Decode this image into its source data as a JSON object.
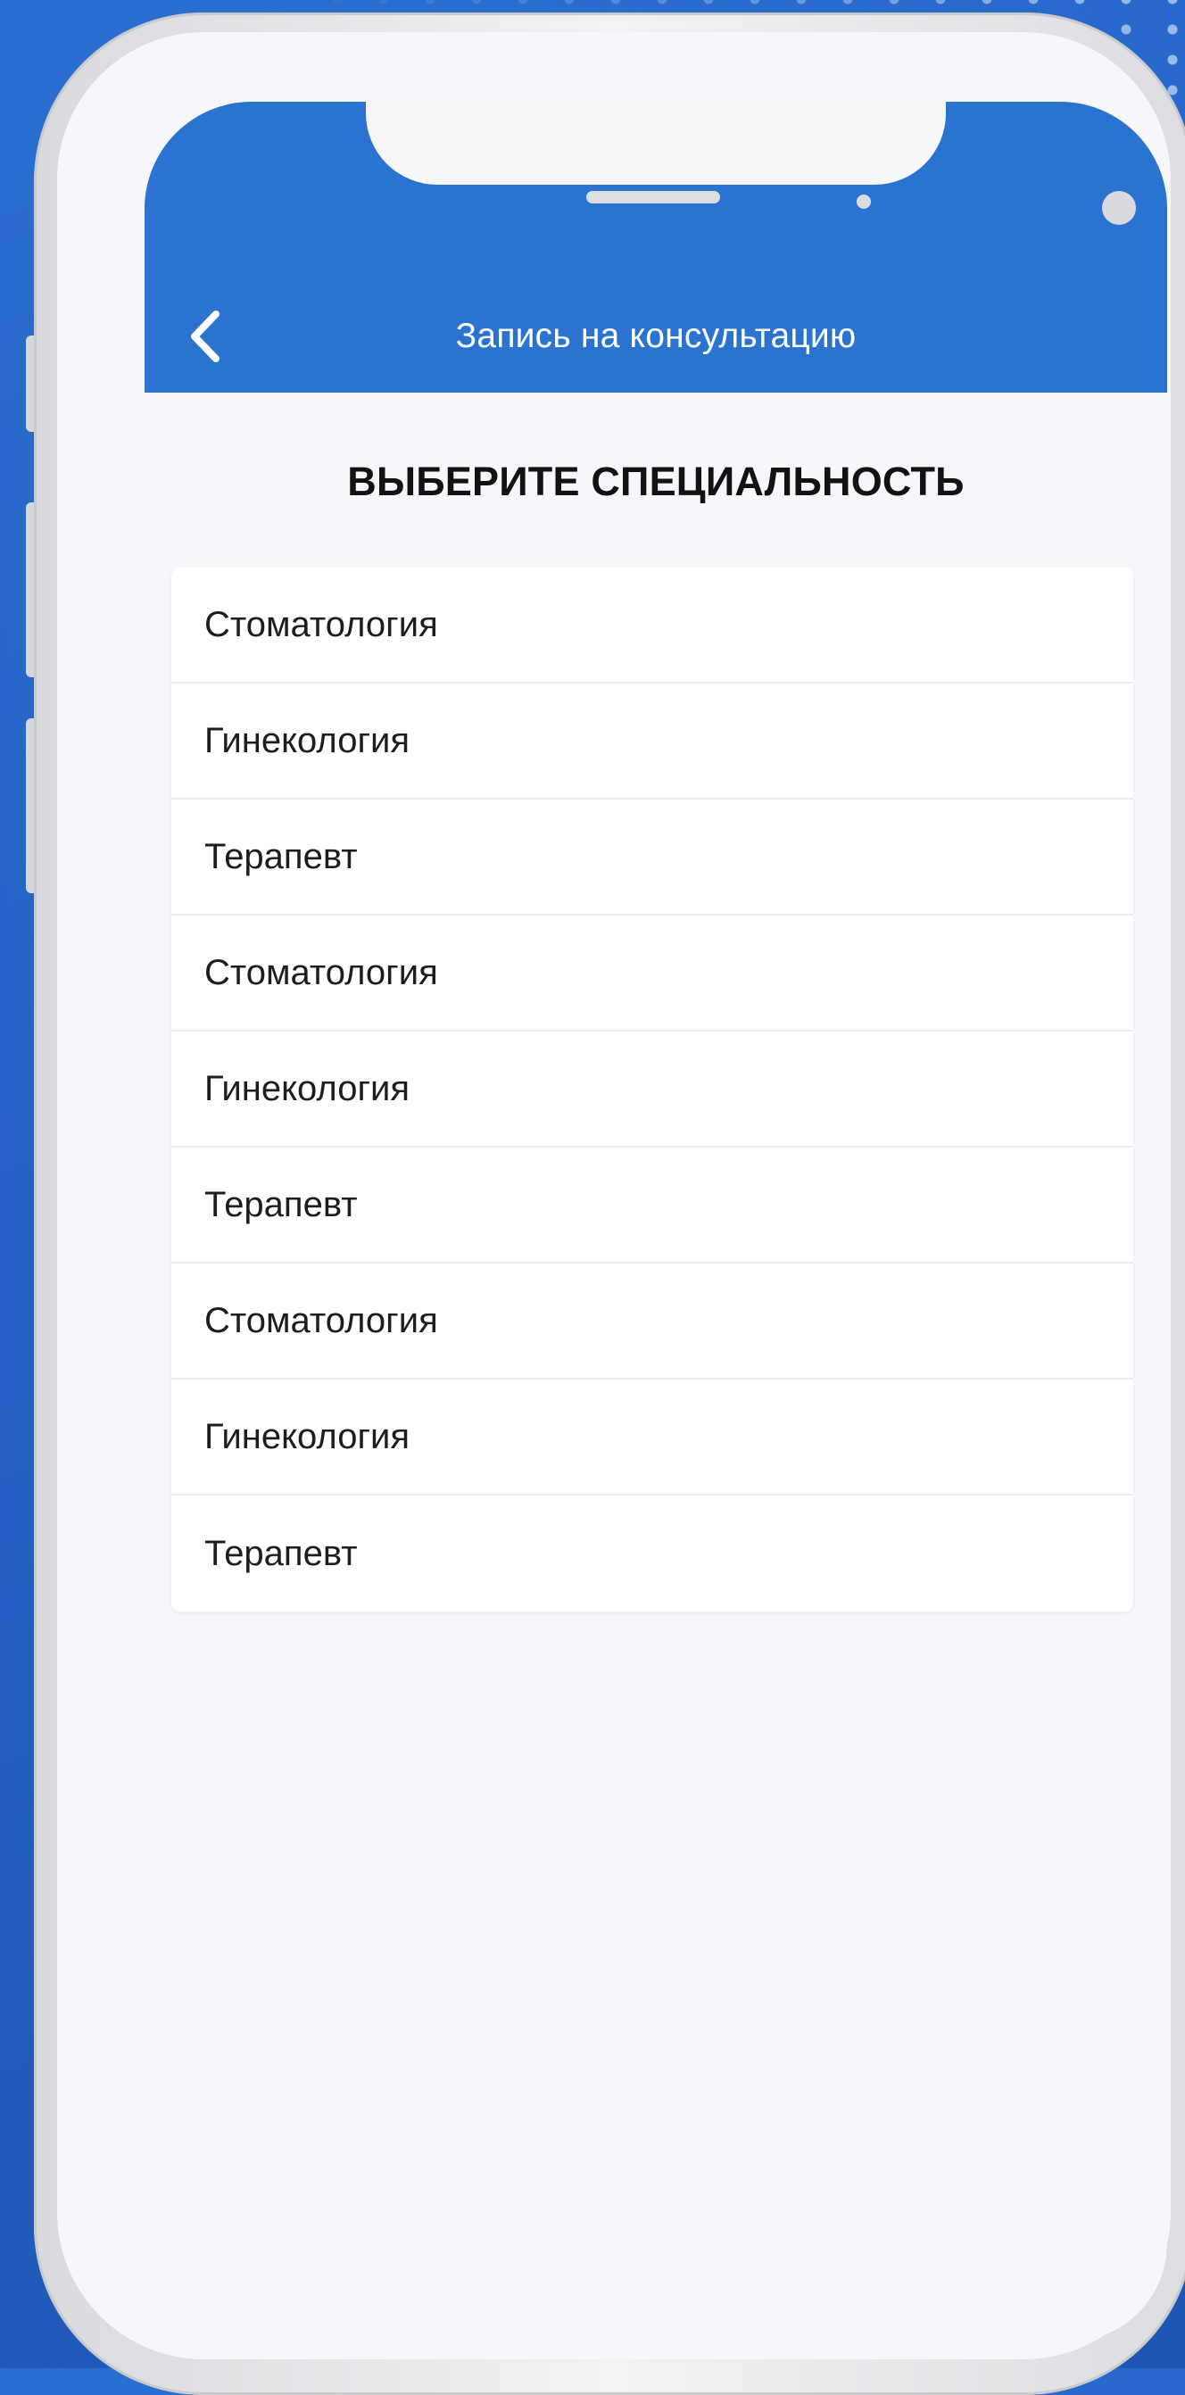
{
  "header": {
    "title": "Запись на консультацию",
    "back_icon": "chevron-left-icon"
  },
  "page": {
    "heading": "ВЫБЕРИТЕ СПЕЦИАЛЬНОСТЬ"
  },
  "specialties": [
    "Стоматология",
    "Гинекология",
    "Терапевт",
    "Стоматология",
    "Гинекология",
    "Терапевт",
    "Стоматология",
    "Гинекология",
    "Терапевт"
  ],
  "colors": {
    "accent": "#2a73d0",
    "background": "#1f5bbd",
    "screen": "#f6f7fb"
  }
}
